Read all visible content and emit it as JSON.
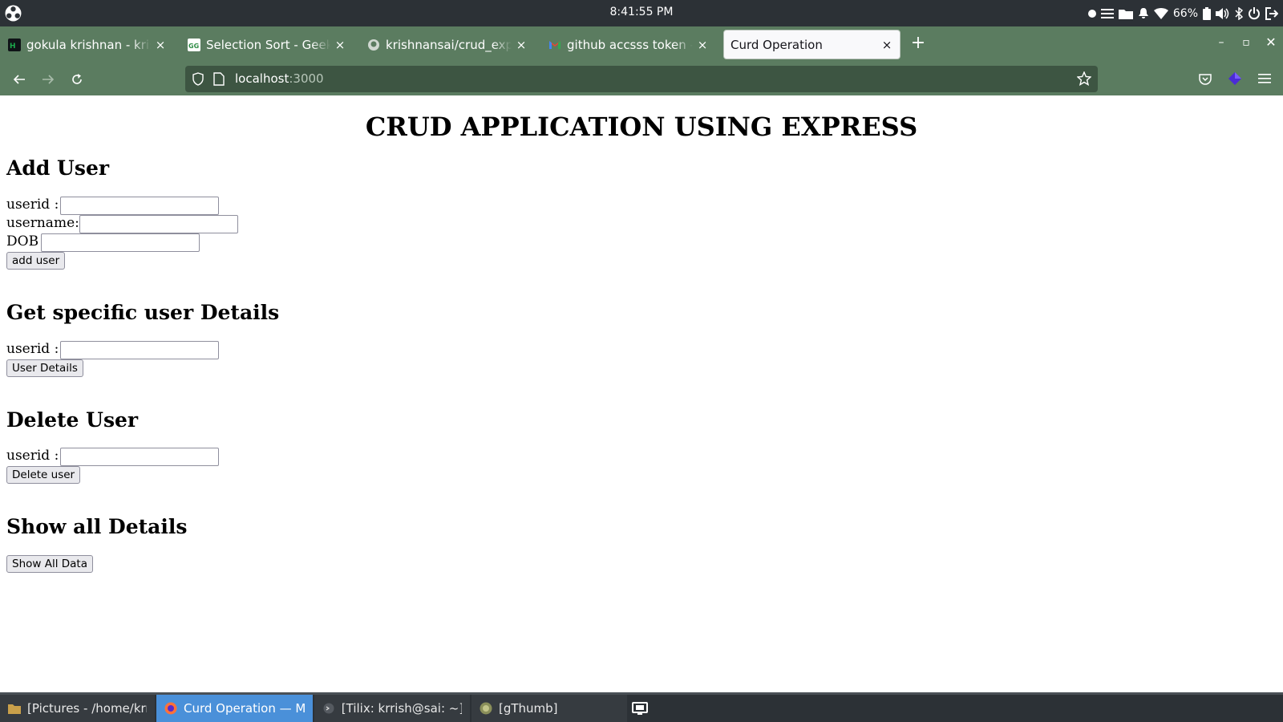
{
  "system_bar": {
    "clock": "8:41:55 PM",
    "battery_percent": "66%",
    "tray_icons": [
      "record-dot-icon",
      "menu-lines-icon",
      "folder-icon",
      "bell-icon",
      "wifi-icon",
      "battery-icon",
      "volume-icon",
      "bluetooth-icon",
      "power-icon",
      "logout-icon"
    ]
  },
  "browser": {
    "tabs": [
      {
        "label": "gokula krishnan - krishnansai",
        "icon": "hackerrank-icon",
        "icon_color": "#1ba94c",
        "active": false
      },
      {
        "label": "Selection Sort - GeeksforGeeks",
        "icon": "geeksforgeeks-icon",
        "icon_color": "#2f8d46",
        "active": false
      },
      {
        "label": "krishnansai/crud_express",
        "icon": "github-icon",
        "icon_color": "#ffffff",
        "active": false
      },
      {
        "label": "github accsss token - Google",
        "icon": "gmail-icon",
        "icon_color": "#ea4335",
        "active": false
      },
      {
        "label": "Curd Operation",
        "icon": "",
        "icon_color": "",
        "active": true
      }
    ],
    "new_tab_label": "+",
    "close_label": "×",
    "url_host": "localhost",
    "url_port": ":3000",
    "theme_color": "#5b7c60"
  },
  "page": {
    "title": "CRUD APPLICATION USING EXPRESS",
    "add_user": {
      "heading": "Add User",
      "userid_label": "userid :",
      "userid_value": "",
      "username_label": "username:",
      "username_value": "",
      "dob_label": "DOB",
      "dob_value": "",
      "button": "add user"
    },
    "get_user": {
      "heading": "Get specific user Details",
      "userid_label": "userid :",
      "userid_value": "",
      "button": "User Details"
    },
    "delete_user": {
      "heading": "Delete User",
      "userid_label": "userid :",
      "userid_value": "",
      "button": "Delete user"
    },
    "show_all": {
      "heading": "Show all Details",
      "button": "Show All Data"
    }
  },
  "taskbar": {
    "items": [
      {
        "label": "[Pictures - /home/krrish/Pictures]",
        "icon": "folder-icon",
        "active": false
      },
      {
        "label": "Curd Operation — Mozilla Firefox",
        "icon": "firefox-icon",
        "active": true
      },
      {
        "label": "[Tilix: krrish@sai: ~]",
        "icon": "terminal-icon",
        "active": false
      },
      {
        "label": "[gThumb]",
        "icon": "gthumb-icon",
        "active": false
      }
    ],
    "accent_color": "#4a90d9"
  }
}
